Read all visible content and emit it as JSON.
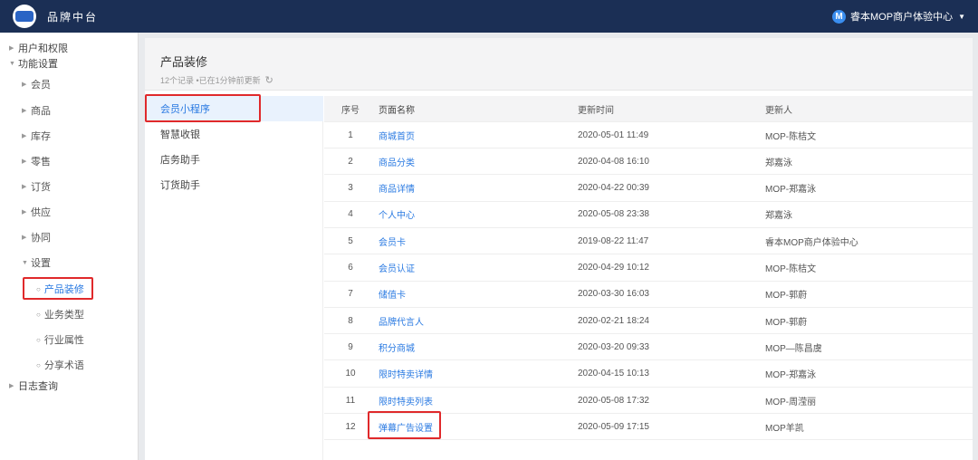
{
  "app": {
    "title": "品牌中台",
    "user_initial": "M",
    "user_name": "睿本MOP商户体验中心"
  },
  "sidebar": {
    "items": [
      {
        "label": "用户和权限",
        "level": 0
      },
      {
        "label": "功能设置",
        "level": 0
      },
      {
        "label": "会员",
        "level": 1
      },
      {
        "label": "商品",
        "level": 1
      },
      {
        "label": "库存",
        "level": 1
      },
      {
        "label": "零售",
        "level": 1
      },
      {
        "label": "订货",
        "level": 1
      },
      {
        "label": "供应",
        "level": 1
      },
      {
        "label": "协同",
        "level": 1
      },
      {
        "label": "设置",
        "level": 1
      },
      {
        "label": "产品装修",
        "level": 2
      },
      {
        "label": "业务类型",
        "level": 2
      },
      {
        "label": "行业属性",
        "level": 2
      },
      {
        "label": "分享术语",
        "level": 2
      },
      {
        "label": "日志查询",
        "level": 0
      }
    ],
    "active": "产品装修"
  },
  "page": {
    "title": "产品装修",
    "sub_info": "12个记录 •已在1分钟前更新"
  },
  "categories": [
    "会员小程序",
    "智慧收银",
    "店务助手",
    "订货助手"
  ],
  "active_category": "会员小程序",
  "table": {
    "headers": [
      "序号",
      "页面名称",
      "更新时间",
      "更新人"
    ],
    "rows": [
      [
        "1",
        "商城首页",
        "2020-05-01 11:49",
        "MOP-陈桔文"
      ],
      [
        "2",
        "商品分类",
        "2020-04-08 16:10",
        "郑嘉泳"
      ],
      [
        "3",
        "商品详情",
        "2020-04-22 00:39",
        "MOP-郑嘉泳"
      ],
      [
        "4",
        "个人中心",
        "2020-05-08 23:38",
        "郑嘉泳"
      ],
      [
        "5",
        "会员卡",
        "2019-08-22 11:47",
        "睿本MOP商户体验中心"
      ],
      [
        "6",
        "会员认证",
        "2020-04-29 10:12",
        "MOP-陈桔文"
      ],
      [
        "7",
        "储值卡",
        "2020-03-30 16:03",
        "MOP-郭蔚"
      ],
      [
        "8",
        "品牌代言人",
        "2020-02-21 18:24",
        "MOP-郭蔚"
      ],
      [
        "9",
        "积分商城",
        "2020-03-20 09:33",
        "MOP—陈昌虞"
      ],
      [
        "10",
        "限时特卖详情",
        "2020-04-15 10:13",
        "MOP-郑嘉泳"
      ],
      [
        "11",
        "限时特卖列表",
        "2020-05-08 17:32",
        "MOP-周滢丽"
      ],
      [
        "12",
        "弹幕广告设置",
        "2020-05-09 17:15",
        "MOP羊凯"
      ]
    ]
  }
}
